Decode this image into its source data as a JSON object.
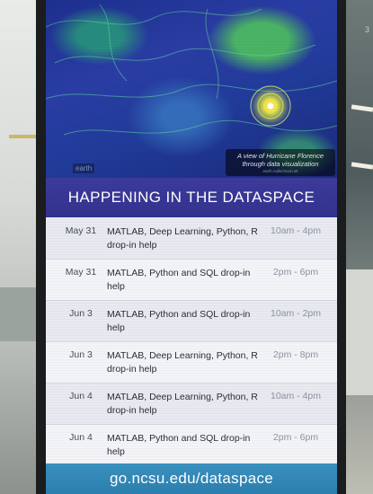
{
  "visualization": {
    "brand_tag": "earth",
    "caption": "A view of Hurricane Florence through data visualization",
    "caption_credit": "earth.nullschool.net"
  },
  "banner": {
    "title": "HAPPENING IN THE DATASPACE"
  },
  "events": [
    {
      "date": "May 31",
      "title": "MATLAB, Deep Learning, Python, R drop-in help",
      "time": "10am - 4pm"
    },
    {
      "date": "May 31",
      "title": "MATLAB, Python and SQL drop-in help",
      "time": "2pm - 6pm"
    },
    {
      "date": "Jun 3",
      "title": "MATLAB, Python and SQL drop-in help",
      "time": "10am - 2pm"
    },
    {
      "date": "Jun 3",
      "title": "MATLAB, Deep Learning, Python, R drop-in help",
      "time": "2pm - 8pm"
    },
    {
      "date": "Jun 4",
      "title": "MATLAB, Deep Learning, Python, R drop-in help",
      "time": "10am - 4pm"
    },
    {
      "date": "Jun 4",
      "title": "MATLAB, Python and SQL drop-in help",
      "time": "2pm - 6pm"
    }
  ],
  "footer": {
    "url": "go.ncsu.edu/dataspace"
  },
  "side_tag": "3"
}
